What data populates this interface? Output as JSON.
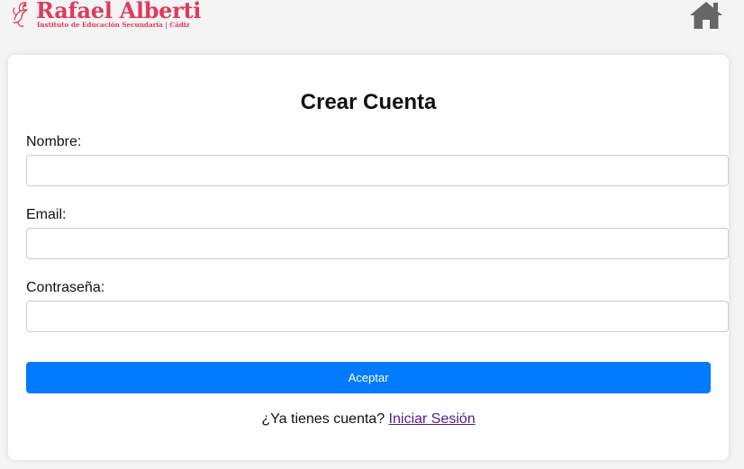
{
  "header": {
    "logo": {
      "title": "Rafael Alberti",
      "subtitle": "Instituto de Educación Secundaria | Cádiz",
      "color": "#e03a5c"
    },
    "home_icon": "home-icon"
  },
  "form": {
    "title": "Crear Cuenta",
    "fields": [
      {
        "label": "Nombre:",
        "value": "",
        "placeholder": ""
      },
      {
        "label": "Email:",
        "value": "",
        "placeholder": ""
      },
      {
        "label": "Contraseña:",
        "value": "",
        "placeholder": ""
      }
    ],
    "submit_label": "Aceptar",
    "submit_color": "#007bff",
    "login_prompt": "¿Ya tienes cuenta?",
    "login_link": "Iniciar Sesión"
  }
}
